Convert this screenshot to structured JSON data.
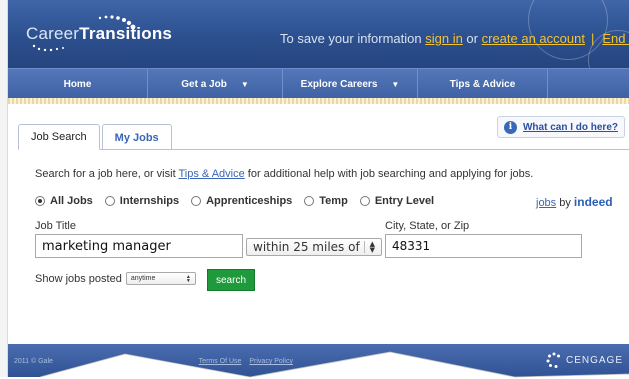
{
  "header": {
    "logo_regular": "Career",
    "logo_bold": "Transitions",
    "message_prefix": "To save your information ",
    "sign_in": "sign in",
    "message_or": " or ",
    "create_account": "create an account",
    "separator": "|",
    "end_session": "End Session"
  },
  "nav": {
    "items": [
      {
        "label": "Home",
        "caret": ""
      },
      {
        "label": "Get a Job",
        "caret": "▼"
      },
      {
        "label": "Explore Careers",
        "caret": "▼"
      },
      {
        "label": "Tips & Advice",
        "caret": ""
      }
    ]
  },
  "tabs": [
    {
      "label": "Job Search"
    },
    {
      "label": "My Jobs"
    }
  ],
  "help": {
    "icon_glyph": "i",
    "label": "What can I do here?"
  },
  "intro": {
    "prefix": "Search for a job here, or visit ",
    "link": "Tips & Advice",
    "suffix": " for additional help with job searching and applying for jobs."
  },
  "job_types": [
    {
      "label": "All Jobs",
      "selected": true
    },
    {
      "label": "Internships",
      "selected": false
    },
    {
      "label": "Apprenticeships",
      "selected": false
    },
    {
      "label": "Temp",
      "selected": false
    },
    {
      "label": "Entry Level",
      "selected": false
    }
  ],
  "indeed": {
    "link": "jobs",
    "by": " by ",
    "brand": "indeed"
  },
  "form": {
    "job_title_label": "Job Title",
    "job_title_value": "marketing manager",
    "distance_value": "within 25 miles of",
    "location_label": "City, State, or Zip",
    "location_value": "48331",
    "posted_label": "Show jobs posted",
    "posted_value": "anytime",
    "search_label": "search"
  },
  "footer": {
    "copyright": "2011 © Gale",
    "terms": "Terms Of Use",
    "privacy": "Privacy Policy",
    "brand": "CENGAGE"
  },
  "colors": {
    "header_blue": "#2c4f8e",
    "link_blue": "#3a64b6",
    "accent_gold": "#f2c430",
    "search_green": "#1e9a3c"
  }
}
